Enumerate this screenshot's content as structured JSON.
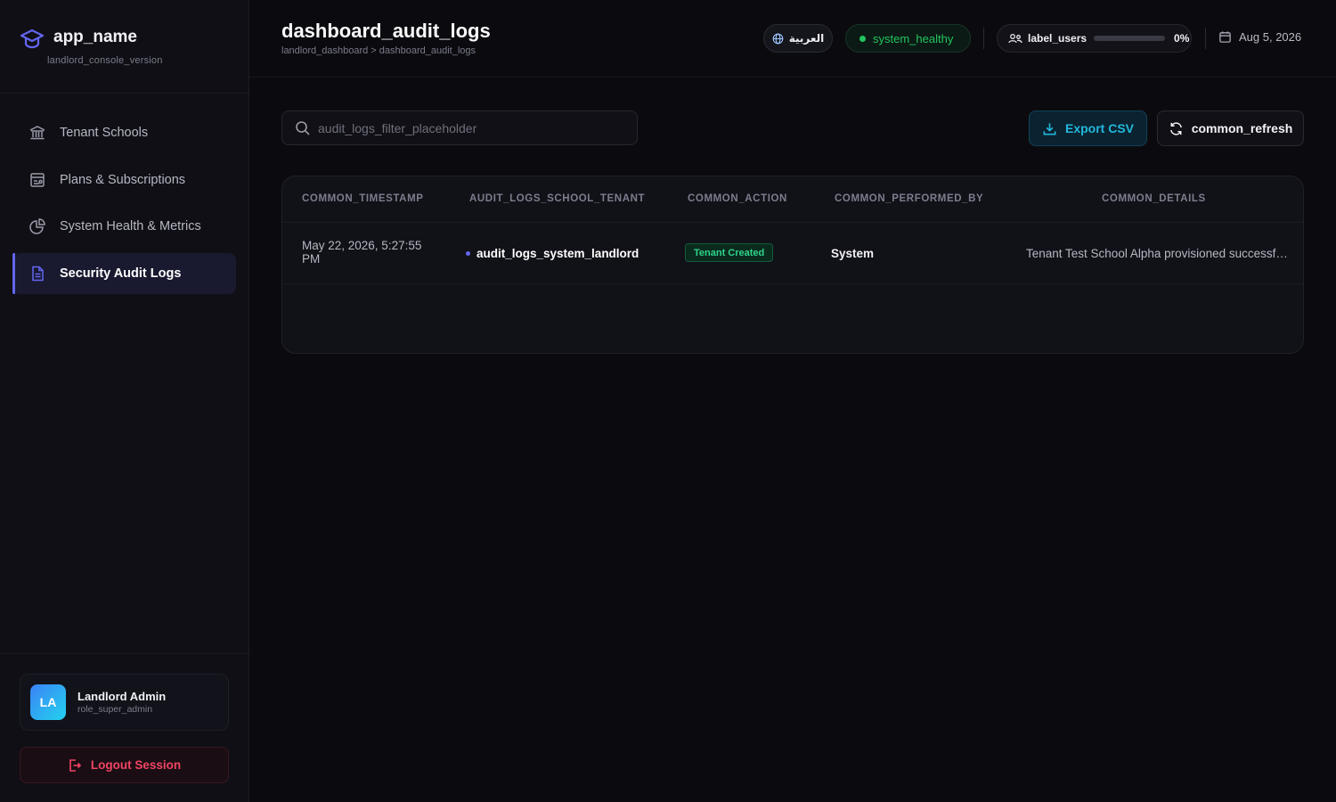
{
  "sidebar": {
    "app_name": "app_name",
    "version": "landlord_console_version",
    "items": [
      {
        "label": "Tenant Schools",
        "icon": "school-building-icon",
        "active": false
      },
      {
        "label": "Plans & Subscriptions",
        "icon": "subscription-card-icon",
        "active": false
      },
      {
        "label": "System Health & Metrics",
        "icon": "pie-chart-icon",
        "active": false
      },
      {
        "label": "Security Audit Logs",
        "icon": "document-icon",
        "active": true
      }
    ],
    "user": {
      "initials": "LA",
      "name": "Landlord Admin",
      "role": "role_super_admin"
    },
    "logout_label": "Logout Session"
  },
  "header": {
    "title": "dashboard_audit_logs",
    "breadcrumb": "landlord_dashboard > dashboard_audit_logs",
    "language_label": "العربية",
    "health_label": "system_healthy",
    "users_label": "label_users",
    "users_percent": "0%",
    "users_fraction": 0,
    "date": "Aug 5, 2026"
  },
  "toolbar": {
    "search_placeholder": "audit_logs_filter_placeholder",
    "export_label": "Export CSV",
    "refresh_label": "common_refresh"
  },
  "table": {
    "columns": [
      "COMMON_TIMESTAMP",
      "AUDIT_LOGS_SCHOOL_TENANT",
      "COMMON_ACTION",
      "COMMON_PERFORMED_BY",
      "COMMON_DETAILS"
    ],
    "rows": [
      {
        "timestamp": "May 22, 2026, 5:27:55 PM",
        "tenant": "audit_logs_system_landlord",
        "action": "Tenant Created",
        "performed_by": "System",
        "details": "Tenant Test School Alpha provisioned successfully"
      }
    ]
  },
  "colors": {
    "accent": "#6366f1",
    "success": "#22c55e",
    "export": "#22b8dc",
    "danger": "#f04463"
  }
}
